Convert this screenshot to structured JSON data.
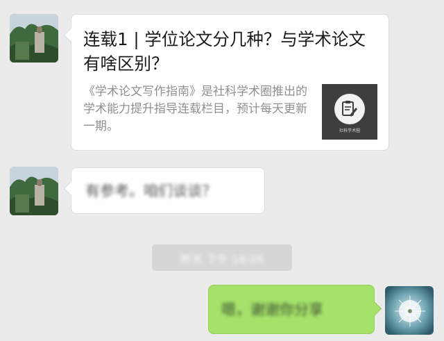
{
  "messages": [
    {
      "sender": "other",
      "type": "article",
      "avatar_icon": "landscape-photo-icon",
      "article": {
        "title": "连载1 | 学位论文分几种？与学术论文有啥区别？",
        "description": "《学术论文写作指南》是社科学术圈推出的学术能力提升指导连载栏目，预计每天更新一期。",
        "thumbnail_icon": "document-pen-icon",
        "thumbnail_caption": "社科学术圈"
      }
    },
    {
      "sender": "other",
      "type": "text",
      "avatar_icon": "landscape-photo-icon",
      "text": "有参考。咱们谈谈？"
    },
    {
      "type": "timestamp",
      "text": "昨天 下午 16:05"
    },
    {
      "sender": "self",
      "type": "text",
      "avatar_icon": "dandelion-photo-icon",
      "text": "嗯，谢谢你分享"
    }
  ],
  "colors": {
    "background": "#ebebeb",
    "received_bubble": "#ffffff",
    "sent_bubble": "#a5e26a",
    "title_text": "#1a1a1a",
    "description_text": "#8f8f8f",
    "timestamp_pill": "#d6d6d6",
    "thumbnail_bg": "#3e3e3e"
  }
}
